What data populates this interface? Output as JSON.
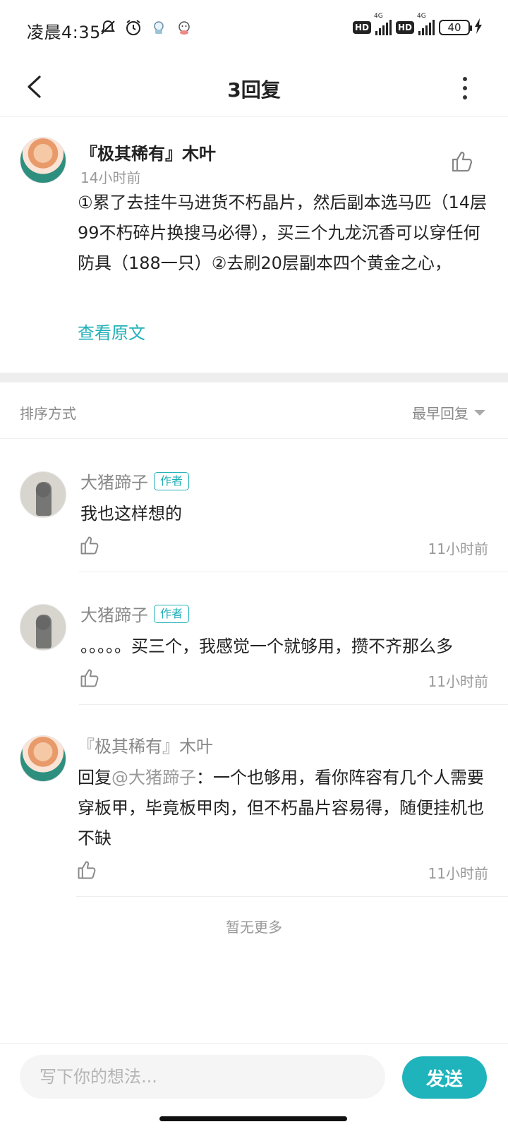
{
  "status_bar": {
    "time": "凌晨4:35",
    "icons_left": [
      "mute-icon",
      "alarm-icon",
      "app-notification-icon",
      "app-notification-icon"
    ],
    "hd1": "HD",
    "net1": "4G",
    "hd2": "HD",
    "net2": "4G",
    "battery": "40"
  },
  "header": {
    "title": "3回复"
  },
  "main_comment": {
    "author": "『极其稀有』木叶",
    "time": "14小时前",
    "text": "①累了去挂牛马进货不朽晶片，然后副本选马匹（14层99不朽碎片换搜马必得），买三个九龙沉香可以穿任何防具（188一只）②去刷20层副本四个黄金之心，",
    "view_original": "查看原文"
  },
  "sort": {
    "label": "排序方式",
    "selected": "最早回复"
  },
  "replies": [
    {
      "author": "大猪蹄子",
      "badge": "作者",
      "text": "我也这样想的",
      "time": "11小时前"
    },
    {
      "author": "大猪蹄子",
      "badge": "作者",
      "text": "。。。。。买三个，我感觉一个就够用，攒不齐那么多",
      "time": "11小时前"
    },
    {
      "author": "『极其稀有』木叶",
      "reply_prefix": "回复",
      "mention": "@大猪蹄子",
      "text": "：一个也够用，看你阵容有几个人需要穿板甲，毕竟板甲肉，但不朽晶片容易得，随便挂机也不缺",
      "time": "11小时前"
    }
  ],
  "footer_note": "暂无更多",
  "input": {
    "placeholder": "写下你的想法...",
    "send_label": "发送"
  },
  "colors": {
    "accent": "#1fb4bc",
    "text": "#222222",
    "muted": "#999999"
  }
}
